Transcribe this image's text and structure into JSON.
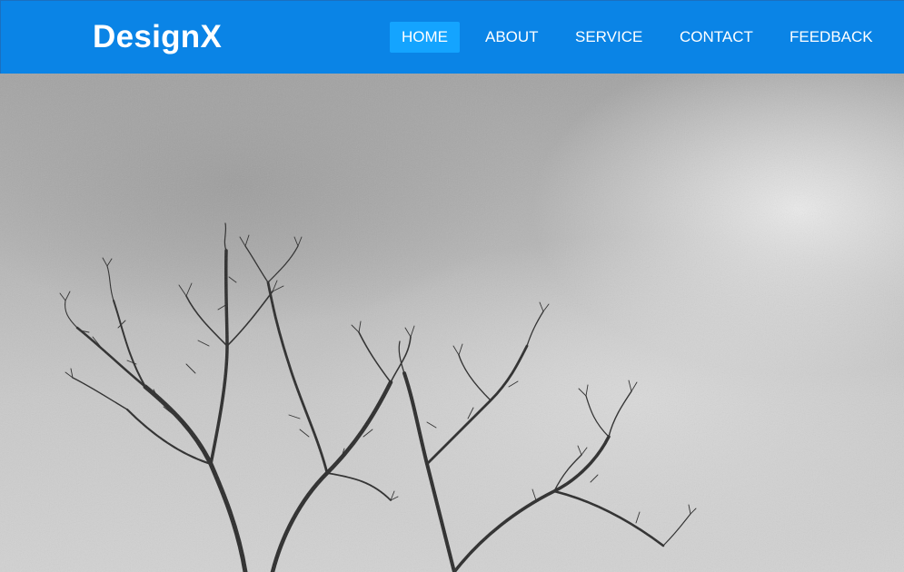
{
  "brand": {
    "logo_text": "DesignX"
  },
  "nav": {
    "items": [
      {
        "label": "HOME",
        "active": true
      },
      {
        "label": "ABOUT",
        "active": false
      },
      {
        "label": "SERVICE",
        "active": false
      },
      {
        "label": "CONTACT",
        "active": false
      },
      {
        "label": "FEEDBACK",
        "active": false
      }
    ]
  },
  "hero": {
    "image_subject": "bare tree branches against a grey overcast sky (black and white photo)"
  },
  "colors": {
    "navbar_bg": "#0a84e6",
    "nav_active_bg": "#14a4ff",
    "nav_text": "#ffffff"
  }
}
